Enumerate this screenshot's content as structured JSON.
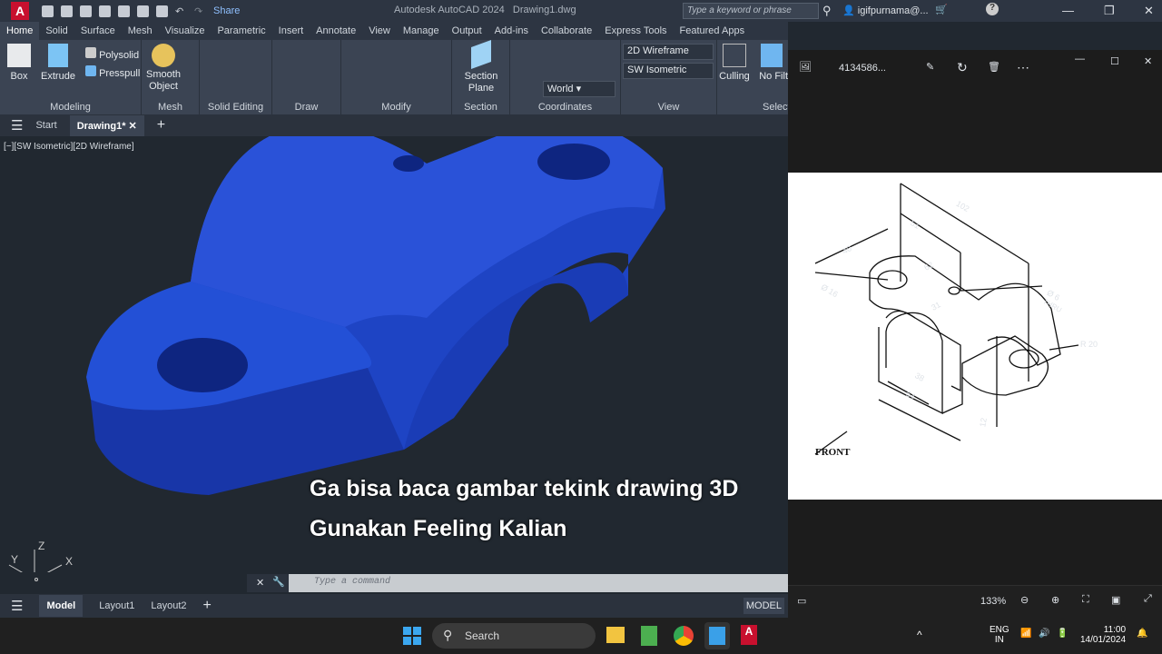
{
  "app": {
    "logo": "A",
    "share": "Share",
    "title": "Autodesk AutoCAD 2024",
    "document": "Drawing1.dwg",
    "search_placeholder": "Type a keyword or phrase",
    "user": "igifpurnama@...",
    "window_controls": [
      "minimize",
      "restore",
      "close"
    ]
  },
  "ribbon_tabs": [
    "Home",
    "Solid",
    "Surface",
    "Mesh",
    "Visualize",
    "Parametric",
    "Insert",
    "Annotate",
    "View",
    "Manage",
    "Output",
    "Add-ins",
    "Collaborate",
    "Express Tools",
    "Featured Apps"
  ],
  "ribbon": {
    "modeling": {
      "label": "Modeling",
      "box": "Box",
      "extrude": "Extrude",
      "polysolid": "Polysolid",
      "presspull": "Presspull"
    },
    "mesh": {
      "label": "Mesh",
      "smooth": "Smooth",
      "object": "Object"
    },
    "solid_editing": {
      "label": "Solid Editing"
    },
    "draw": {
      "label": "Draw"
    },
    "modify": {
      "label": "Modify"
    },
    "section": {
      "label": "Section",
      "plane1": "Section",
      "plane2": "Plane"
    },
    "coordinates": {
      "label": "Coordinates",
      "ucs": "World"
    },
    "view": {
      "label": "View",
      "visual_style": "2D Wireframe",
      "view_dir": "SW Isometric"
    },
    "selection": {
      "label": "Selection",
      "culling": "Culling",
      "filter": "No Filter"
    }
  },
  "file_tabs": {
    "start": "Start",
    "drawing": "Drawing1*"
  },
  "viewport": {
    "label": "[−][SW Isometric][2D Wireframe]",
    "model_color": "#1f4fd6",
    "ucs": {
      "x": "X",
      "y": "Y",
      "z": "Z"
    }
  },
  "captions": [
    "Ga bisa baca gambar tekink drawing 3D",
    "Gunakan Feeling Kalian"
  ],
  "command": {
    "placeholder": "Type a command"
  },
  "layout_tabs": [
    "Model",
    "Layout1",
    "Layout2"
  ],
  "status": {
    "model": "MODEL"
  },
  "photos": {
    "filename": "4134586...",
    "zoom": "133%",
    "drawing": {
      "dims": [
        "102",
        "51",
        "40",
        "62",
        "31",
        "38",
        "64",
        "12"
      ],
      "hole_left": "Ø 16",
      "hole_top": "Ø 6",
      "thru": "THRU",
      "radius": "R 20",
      "front": "FRONT"
    }
  },
  "taskbar": {
    "search": "Search",
    "lang1": "ENG",
    "lang2": "IN",
    "time": "11:00",
    "date": "14/01/2024"
  }
}
